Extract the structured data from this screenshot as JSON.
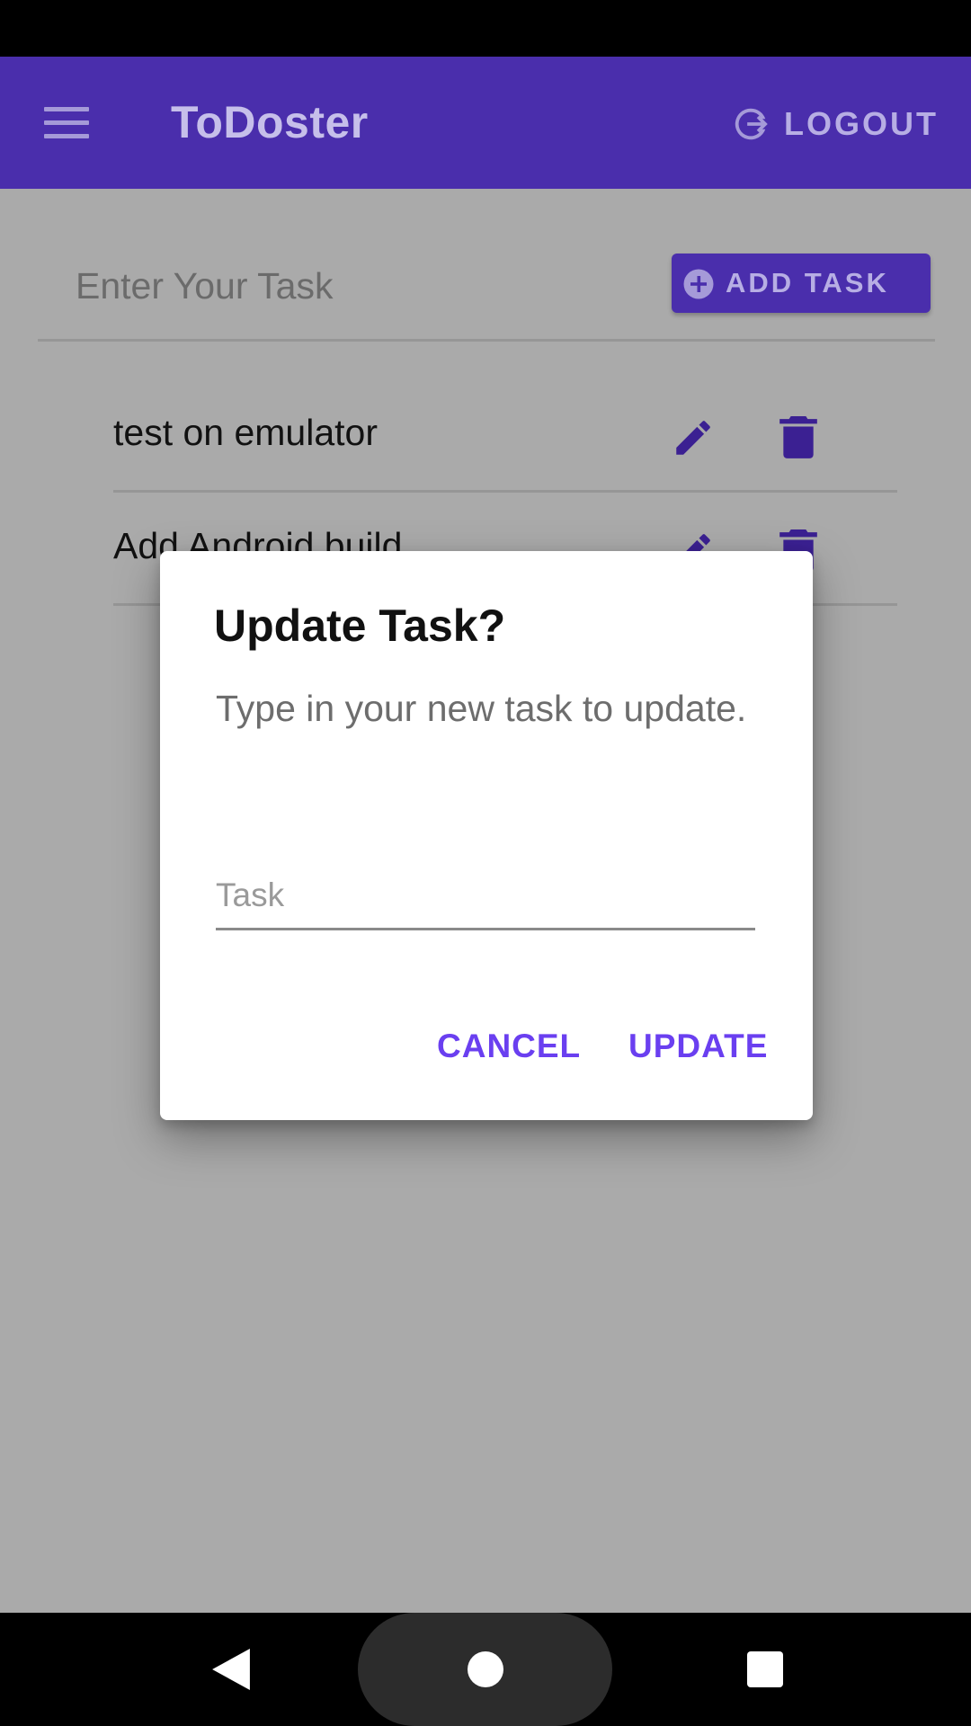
{
  "app_bar": {
    "title": "ToDoster",
    "logout_label": "LOGOUT",
    "menu_icon": "menu-icon",
    "logout_icon": "logout-icon"
  },
  "task_entry": {
    "placeholder": "Enter Your Task",
    "add_button_label": "ADD TASK",
    "add_icon": "add-circle-icon"
  },
  "tasks": [
    {
      "text": "test on emulator"
    },
    {
      "text": "Add Android build"
    }
  ],
  "dialog": {
    "title": "Update Task?",
    "message": "Type in your new task to update.",
    "input_placeholder": "Task",
    "cancel_label": "CANCEL",
    "update_label": "UPDATE"
  },
  "colors": {
    "primary": "#4a2eac",
    "accent": "#6a3ff0",
    "scrim_background": "#aaaaaa"
  }
}
